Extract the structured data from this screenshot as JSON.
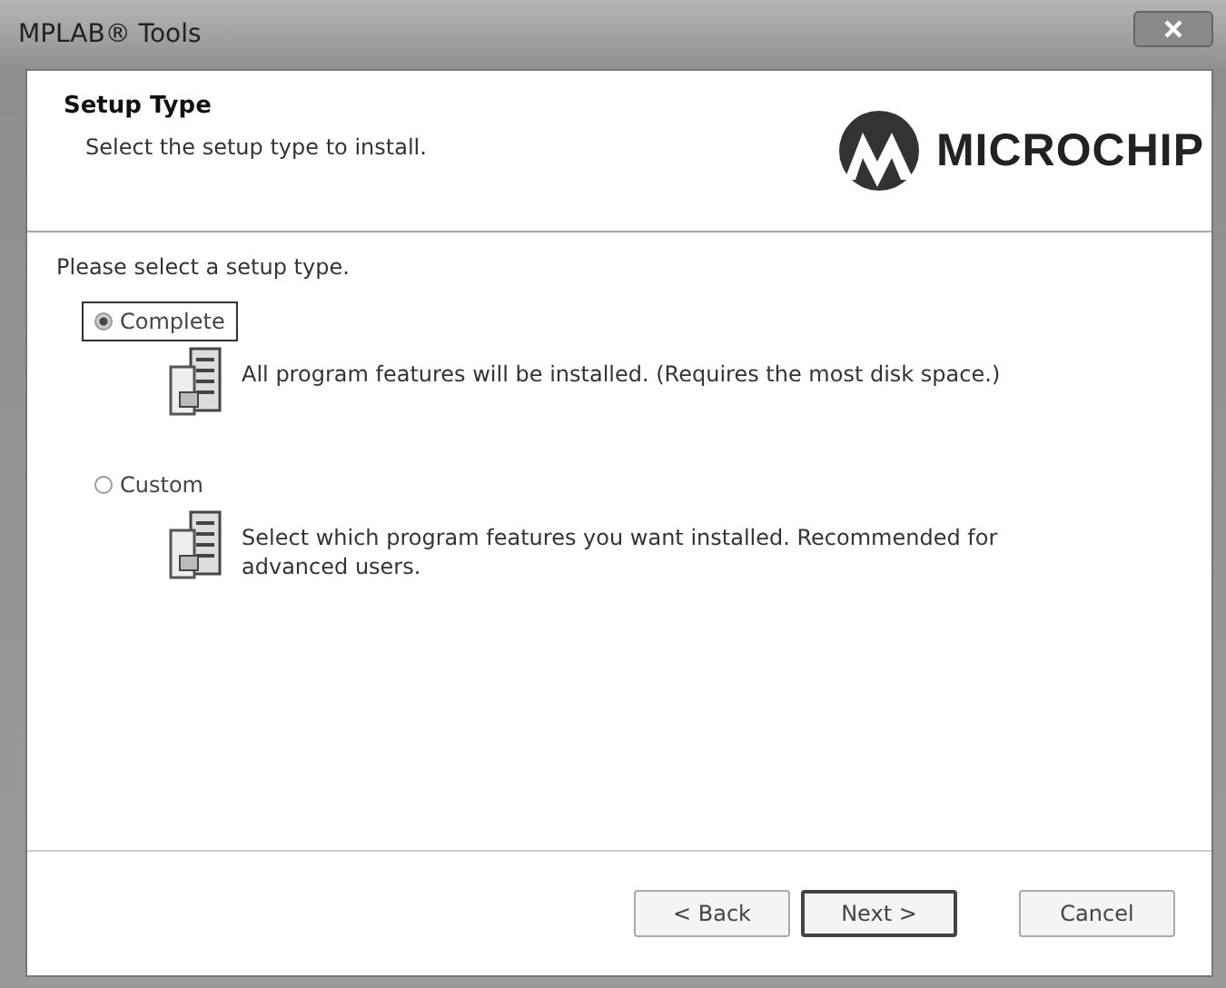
{
  "window": {
    "title": "MPLAB® Tools"
  },
  "header": {
    "title": "Setup Type",
    "subtitle": "Select the setup type to install.",
    "logo_text": "MICROCHIP"
  },
  "prompt": "Please select a setup type.",
  "options": [
    {
      "kind": "radio",
      "label": "Complete",
      "selected": true,
      "description": "All program features will be installed. (Requires the most disk space.)"
    },
    {
      "kind": "radio",
      "label": "Custom",
      "selected": false,
      "description": "Select which program features you want installed. Recommended for advanced users."
    }
  ],
  "buttons": [
    {
      "label": "< Back",
      "default": false
    },
    {
      "label": "Next >",
      "default": true
    },
    {
      "label": "Cancel",
      "default": false
    }
  ]
}
